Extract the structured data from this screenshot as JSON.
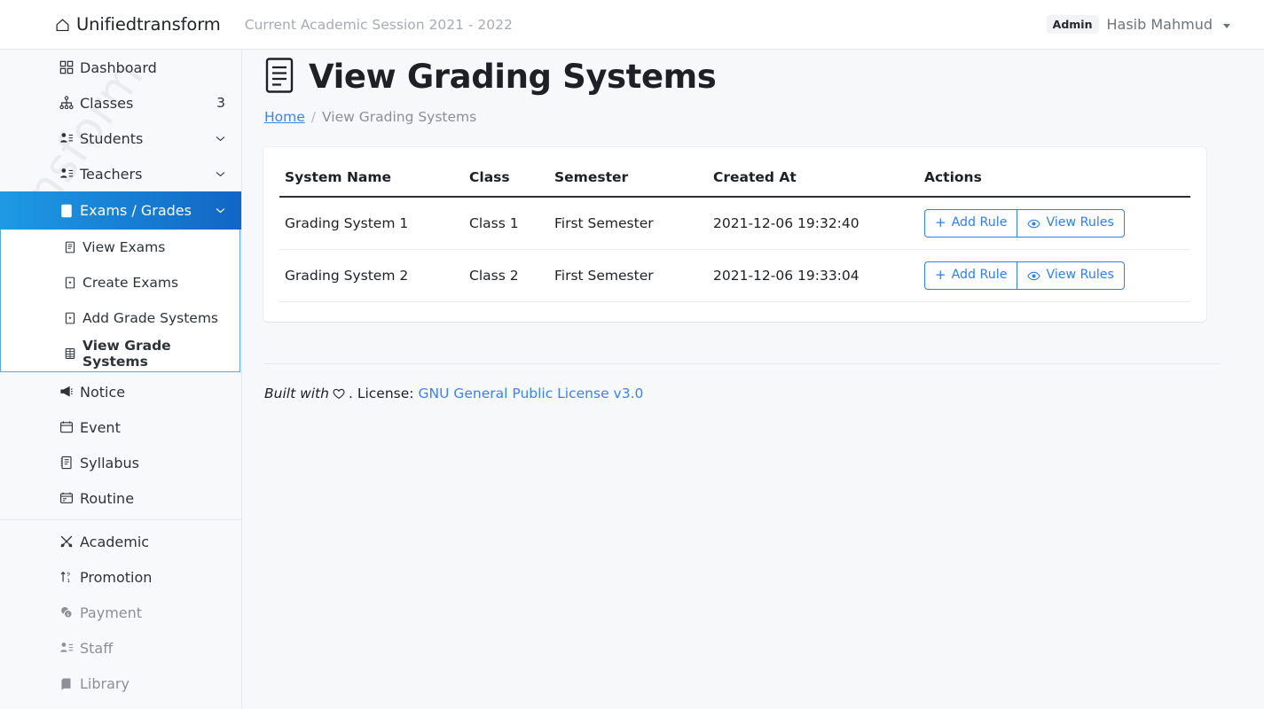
{
  "navbar": {
    "brand": "Unifiedtransform",
    "brand_icon": "home-icon",
    "session": "Current Academic Session 2021 - 2022",
    "role_badge": "Admin",
    "user_name": "Hasib Mahmud",
    "caret_icon": "chevron-down-icon"
  },
  "sidebar": {
    "watermark": "transform",
    "items": [
      {
        "label": "Dashboard",
        "icon": "grid-icon",
        "right": "",
        "muted": false
      },
      {
        "label": "Classes",
        "icon": "sitemap-icon",
        "right": "3",
        "muted": false
      },
      {
        "label": "Students",
        "icon": "users-icon",
        "right": "chevron-down-icon",
        "muted": false
      },
      {
        "label": "Teachers",
        "icon": "users-icon",
        "right": "chevron-down-icon",
        "muted": false
      }
    ],
    "active_item": {
      "label": "Exams / Grades",
      "icon": "document-icon",
      "right": "chevron-down-icon"
    },
    "submenu": [
      {
        "label": "View Exams",
        "icon": "document-icon",
        "current": false
      },
      {
        "label": "Create Exams",
        "icon": "add-box-icon",
        "current": false
      },
      {
        "label": "Add Grade Systems",
        "icon": "add-box-icon",
        "current": false
      },
      {
        "label": "View Grade Systems",
        "icon": "table-icon",
        "current": true
      }
    ],
    "items_after": [
      {
        "label": "Notice",
        "icon": "megaphone-icon",
        "muted": false
      },
      {
        "label": "Event",
        "icon": "calendar-icon",
        "muted": false
      },
      {
        "label": "Syllabus",
        "icon": "notes-icon",
        "muted": false
      },
      {
        "label": "Routine",
        "icon": "schedule-icon",
        "muted": false
      }
    ],
    "items_bottom": [
      {
        "label": "Academic",
        "icon": "tools-icon",
        "muted": false
      },
      {
        "label": "Promotion",
        "icon": "sort-up-icon",
        "muted": false
      },
      {
        "label": "Payment",
        "icon": "coins-icon",
        "muted": true
      },
      {
        "label": "Staff",
        "icon": "users-icon",
        "muted": true
      },
      {
        "label": "Library",
        "icon": "books-icon",
        "muted": true
      }
    ]
  },
  "page": {
    "title": "View Grading Systems",
    "title_icon": "document-icon",
    "breadcrumb_home": "Home",
    "breadcrumb_sep": "/",
    "breadcrumb_current": "View Grading Systems"
  },
  "table": {
    "headers": [
      "System Name",
      "Class",
      "Semester",
      "Created At",
      "Actions"
    ],
    "rows": [
      {
        "system_name": "Grading System 1",
        "class": "Class 1",
        "semester": "First Semester",
        "created_at": "2021-12-06 19:32:40",
        "add_rule_label": "Add Rule",
        "view_rules_label": "View Rules"
      },
      {
        "system_name": "Grading System 2",
        "class": "Class 2",
        "semester": "First Semester",
        "created_at": "2021-12-06 19:33:04",
        "add_rule_label": "Add Rule",
        "view_rules_label": "View Rules"
      }
    ],
    "plus_symbol": "+"
  },
  "footer": {
    "built_with": "Built with",
    "heart_icon": "heart-icon",
    "license_label": ". License:",
    "license_link": "GNU General Public License v3.0"
  },
  "colors": {
    "accent_blue": "#2f7fee",
    "link_blue": "#3b82f6",
    "active_gradient_start": "#1e9ae4",
    "active_gradient_end": "#1266c4",
    "sidebar_bg": "#f8f9fb",
    "page_bg": "#f7f8fa",
    "muted_text": "#8b9096"
  }
}
